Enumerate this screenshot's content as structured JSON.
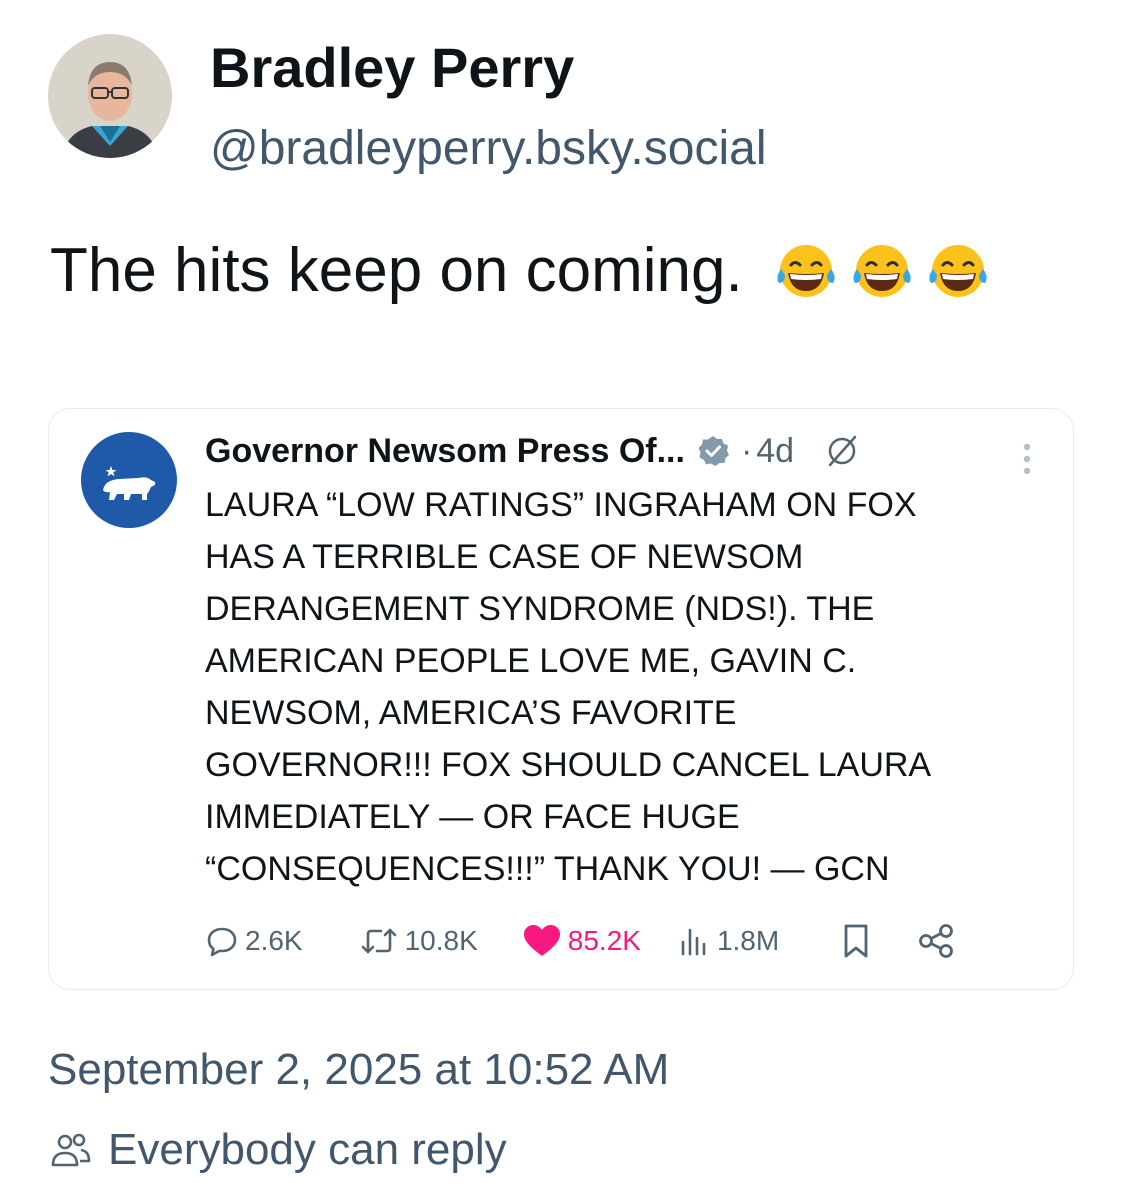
{
  "author": {
    "display_name": "Bradley Perry",
    "handle": "@bradleyperry.bsky.social"
  },
  "post": {
    "text": "The hits keep on coming.",
    "emojis": [
      "face-with-tears-of-joy",
      "face-with-tears-of-joy",
      "face-with-tears-of-joy"
    ]
  },
  "embed": {
    "name": "Governor Newsom Press Of...",
    "time": "4d",
    "lines": [
      "LAURA “LOW RATINGS” INGRAHAM ON FOX",
      "HAS A TERRIBLE CASE OF NEWSOM",
      "DERANGEMENT SYNDROME (NDS!). THE",
      "AMERICAN PEOPLE LOVE ME, GAVIN C.",
      "NEWSOM, AMERICA’S FAVORITE",
      "GOVERNOR!!! FOX SHOULD CANCEL LAURA",
      "IMMEDIATELY — OR FACE HUGE",
      "“CONSEQUENCES!!!” THANK YOU! — GCN"
    ],
    "stats": {
      "replies": "2.6K",
      "reposts": "10.8K",
      "likes": "85.2K",
      "views": "1.8M"
    }
  },
  "timestamp": "September 2, 2025 at 10:52 AM",
  "reply_setting": "Everybody can reply",
  "colors": {
    "text_primary": "#0f1419",
    "text_secondary": "#42576c",
    "card_muted": "#536471",
    "like": "#f91880",
    "avatar_blue": "#1e5aa8",
    "card_border": "#e8ecef"
  }
}
